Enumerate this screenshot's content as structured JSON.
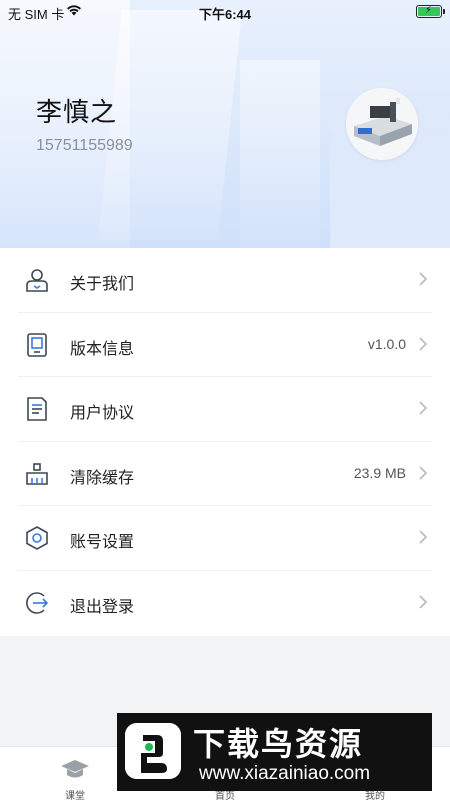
{
  "status_bar": {
    "carrier": "无 SIM 卡",
    "time": "下午6:44",
    "battery_color": "#35c759"
  },
  "profile": {
    "name": "李慎之",
    "phone": "15751155989",
    "avatar_icon": "laser-cutter-machine-image"
  },
  "menu": {
    "items": [
      {
        "label": "关于我们",
        "value": "",
        "icon": "user-badge-icon"
      },
      {
        "label": "版本信息",
        "value": "v1.0.0",
        "icon": "tablet-icon"
      },
      {
        "label": "用户协议",
        "value": "",
        "icon": "document-icon"
      },
      {
        "label": "清除缓存",
        "value": "23.9 MB",
        "icon": "broom-icon"
      },
      {
        "label": "账号设置",
        "value": "",
        "icon": "hexagon-settings-icon"
      },
      {
        "label": "退出登录",
        "value": "",
        "icon": "logout-icon"
      }
    ]
  },
  "tab_bar": {
    "tabs": [
      {
        "label": "课堂",
        "icon": "graduation-cap-icon"
      },
      {
        "label": "首页",
        "icon": "home-icon"
      },
      {
        "label": "我的",
        "icon": "person-icon"
      }
    ]
  },
  "watermark": {
    "title": "下载鸟资源",
    "url": "www.xiazainiao.com"
  },
  "colors": {
    "accent": "#3a7bd5",
    "hero_bg": "#dbe8fb",
    "page_bg": "#f2f3f5"
  }
}
